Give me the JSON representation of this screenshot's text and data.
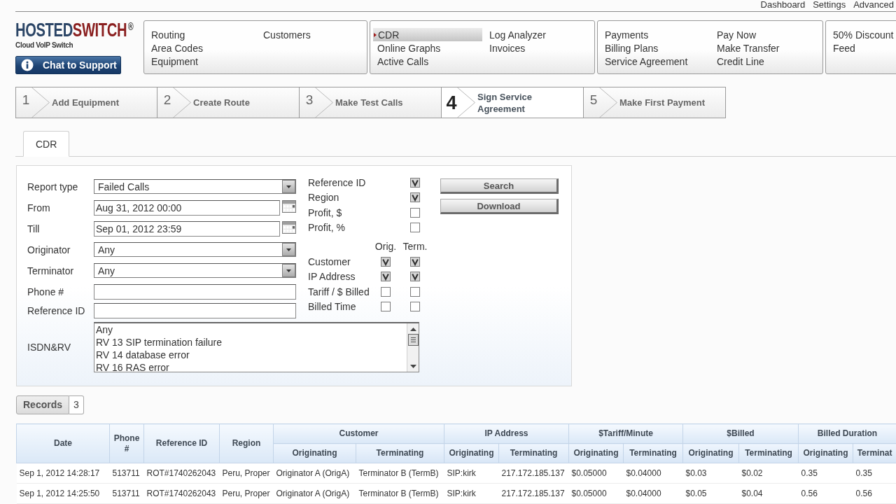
{
  "top_links": [
    {
      "label": "Dashboard"
    },
    {
      "label": "Settings"
    },
    {
      "label": "Advanced"
    }
  ],
  "logo": {
    "word_1": "HOSTED",
    "word_2": "SWITCH",
    "mark": "®",
    "tagline": "Cloud VoIP Switch"
  },
  "support_button": {
    "label": "Chat to Support"
  },
  "nav_groups": [
    {
      "columns": [
        [
          {
            "label": "Routing",
            "selected": false
          },
          {
            "label": "Area Codes",
            "selected": false
          },
          {
            "label": "Equipment",
            "selected": false
          }
        ],
        [
          {
            "label": "Customers",
            "selected": false
          }
        ]
      ]
    },
    {
      "columns": [
        [
          {
            "label": "CDR",
            "selected": true
          },
          {
            "label": "Online Graphs",
            "selected": false
          },
          {
            "label": "Active Calls",
            "selected": false
          }
        ],
        [
          {
            "label": "Log Analyzer",
            "selected": false
          },
          {
            "label": "Invoices",
            "selected": false
          }
        ]
      ]
    },
    {
      "columns": [
        [
          {
            "label": "Payments",
            "selected": false
          },
          {
            "label": "Billing Plans",
            "selected": false
          },
          {
            "label": "Service Agreement",
            "selected": false
          }
        ],
        [
          {
            "label": "Pay Now",
            "selected": false
          },
          {
            "label": "Make Transfer",
            "selected": false
          },
          {
            "label": "Credit Line",
            "selected": false
          }
        ]
      ]
    },
    {
      "columns": [
        [
          {
            "label": "50% Discount",
            "selected": false
          },
          {
            "label": "Feed",
            "selected": false
          }
        ]
      ]
    }
  ],
  "steps": [
    {
      "number": "1",
      "label": "Add Equipment",
      "current": false
    },
    {
      "number": "2",
      "label": "Create Route",
      "current": false
    },
    {
      "number": "3",
      "label": "Make Test Calls",
      "current": false
    },
    {
      "number": "4",
      "label": "Sign Service Agreement",
      "current": true
    },
    {
      "number": "5",
      "label": "Make First Payment",
      "current": false
    }
  ],
  "tabs": [
    {
      "label": "CDR",
      "selected": true
    }
  ],
  "filter_form": {
    "fields": [
      {
        "kind": "select",
        "label": "Report type",
        "value": "Failed Calls"
      },
      {
        "kind": "date",
        "label": "From",
        "value": "Aug 31, 2012 00:00"
      },
      {
        "kind": "date",
        "label": "Till",
        "value": "Sep 01, 2012 23:59"
      },
      {
        "kind": "select",
        "label": "Originator",
        "value": "Any"
      },
      {
        "kind": "select",
        "label": "Terminator",
        "value": "Any"
      },
      {
        "kind": "text",
        "label": "Phone #"
      },
      {
        "kind": "text",
        "label": "Reference ID"
      }
    ],
    "isdn_list": {
      "label": "ISDN&RV",
      "options": [
        "Any",
        "RV 13 SIP termination failure",
        "RV 14 database error",
        "RV 16 RAS error"
      ]
    },
    "column_options": [
      {
        "label": "Reference ID",
        "checked": true
      },
      {
        "label": "Region",
        "checked": true
      },
      {
        "label": "Profit, $",
        "checked": false
      },
      {
        "label": "Profit, %",
        "checked": false
      }
    ],
    "pair_headers": [
      "Orig.",
      "Term."
    ],
    "column_pairs": [
      {
        "label": "Customer",
        "orig_checked": true,
        "term_checked": true
      },
      {
        "label": "IP Address",
        "orig_checked": true,
        "term_checked": true
      },
      {
        "label": "Tariff / $ Billed",
        "orig_checked": false,
        "term_checked": false
      },
      {
        "label": "Billed Time",
        "orig_checked": false,
        "term_checked": false
      }
    ],
    "actions": [
      {
        "label": "Search"
      },
      {
        "label": "Download"
      }
    ]
  },
  "records": {
    "label": "Records",
    "count": "3"
  },
  "table": {
    "header_rows": [
      [
        {
          "label": "Date",
          "rowspan": 2
        },
        {
          "label": "Phone #",
          "rowspan": 2
        },
        {
          "label": "Reference ID",
          "rowspan": 2
        },
        {
          "label": "Region",
          "rowspan": 2
        },
        {
          "label": "Customer",
          "colspan": 2
        },
        {
          "label": "IP Address",
          "colspan": 2
        },
        {
          "label": "$Tariff/Minute",
          "colspan": 2
        },
        {
          "label": "$Billed",
          "colspan": 2
        },
        {
          "label": "Billed Duration",
          "colspan": 2
        }
      ],
      [
        {
          "label": "Originating"
        },
        {
          "label": "Terminating"
        },
        {
          "label": "Originating"
        },
        {
          "label": "Terminating"
        },
        {
          "label": "Originating"
        },
        {
          "label": "Terminating"
        },
        {
          "label": "Originating"
        },
        {
          "label": "Terminating"
        },
        {
          "label": "Originating"
        },
        {
          "label": "Terminat"
        }
      ]
    ],
    "rows": [
      [
        "Sep 1, 2012 14:28:17",
        "513711",
        "ROT#1740262043",
        "Peru, Proper",
        "Originator A (OrigA)",
        "Terminator B (TermB)",
        "SIP:kirk",
        "217.172.185.137",
        "$0.05000",
        "$0.04000",
        "$0.03",
        "$0.02",
        "0.35",
        "0.35"
      ],
      [
        "Sep 1, 2012 14:25:50",
        "513711",
        "ROT#1740262043",
        "Peru, Proper",
        "Originator A (OrigA)",
        "Terminator B (TermB)",
        "SIP:kirk",
        "217.172.185.137",
        "$0.05000",
        "$0.04000",
        "$0.05",
        "$0.04",
        "0.56",
        "0.56"
      ]
    ]
  }
}
